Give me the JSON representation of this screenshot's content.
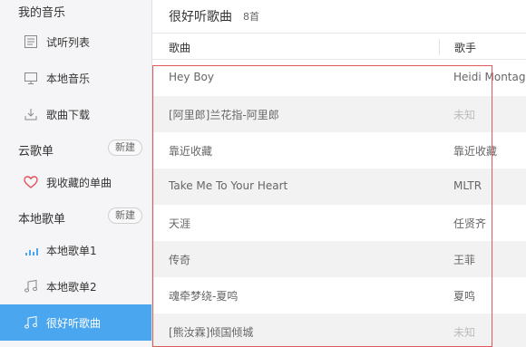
{
  "sidebar": {
    "my_music_title": "我的音乐",
    "my_music_items": [
      {
        "label": "试听列表",
        "icon": "list-icon"
      },
      {
        "label": "本地音乐",
        "icon": "monitor-icon"
      },
      {
        "label": "歌曲下载",
        "icon": "download-icon"
      }
    ],
    "cloud_title": "云歌单",
    "cloud_new": "新建",
    "cloud_items": [
      {
        "label": "我收藏的单曲",
        "icon": "heart-icon"
      }
    ],
    "local_title": "本地歌单",
    "local_new": "新建",
    "local_items": [
      {
        "label": "本地歌单1",
        "icon": "equalizer-icon"
      },
      {
        "label": "本地歌单2",
        "icon": "music-note-icon"
      },
      {
        "label": "很好听歌曲",
        "icon": "music-note-icon",
        "active": true
      }
    ]
  },
  "main": {
    "title": "很好听歌曲",
    "count": "8首",
    "columns": {
      "song": "歌曲",
      "artist": "歌手"
    },
    "songs": [
      {
        "title": "Hey Boy",
        "artist": "Heidi Montag"
      },
      {
        "title": "[阿里郎]兰花指-阿里郎",
        "artist": "未知"
      },
      {
        "title": "靠近收藏",
        "artist": "靠近收藏"
      },
      {
        "title": "Take Me To Your Heart",
        "artist": "MLTR"
      },
      {
        "title": "天涯",
        "artist": "任贤齐"
      },
      {
        "title": "传奇",
        "artist": "王菲"
      },
      {
        "title": "魂牵梦绕-夏鸣",
        "artist": "夏鸣"
      },
      {
        "title": "[熊汝霖]倾国倾城",
        "artist": "未知"
      }
    ]
  },
  "colors": {
    "accent": "#4aa6ee",
    "highlight_border": "#e05a5a",
    "heart": "#e0505a"
  }
}
